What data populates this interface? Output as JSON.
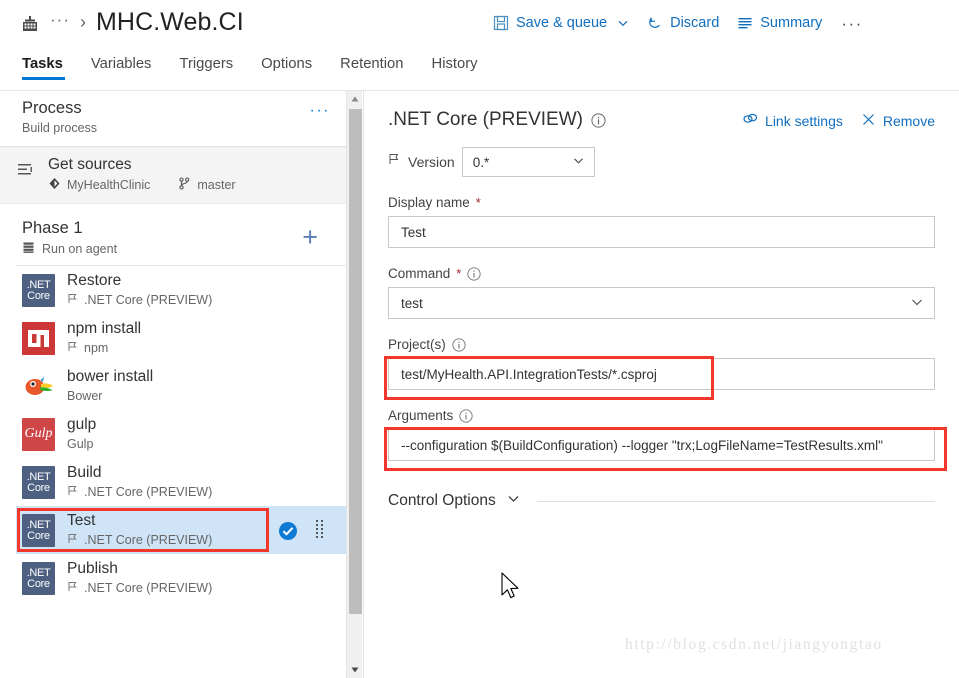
{
  "header": {
    "breadcrumb": {
      "home_icon": "build-definition-icon",
      "overflow": "···",
      "separator": "›",
      "title": "MHC.Web.CI"
    },
    "toolbar": {
      "save_queue_label": "Save & queue",
      "save_icon": "save-icon",
      "caret_icon": "chevron-down-icon",
      "discard_label": "Discard",
      "discard_icon": "undo-icon",
      "summary_label": "Summary",
      "summary_icon": "list-icon",
      "more_label": "···"
    }
  },
  "tabs": [
    {
      "label": "Tasks",
      "active": true
    },
    {
      "label": "Variables",
      "active": false
    },
    {
      "label": "Triggers",
      "active": false
    },
    {
      "label": "Options",
      "active": false
    },
    {
      "label": "Retention",
      "active": false
    },
    {
      "label": "History",
      "active": false
    }
  ],
  "sidebar": {
    "process": {
      "title": "Process",
      "subtitle": "Build process",
      "more_label": "···"
    },
    "get_sources": {
      "icon": "get-sources-icon",
      "title": "Get sources",
      "repo_icon": "repository-icon",
      "repo": "MyHealthClinic",
      "branch_icon": "branch-icon",
      "branch": "master"
    },
    "phase": {
      "title": "Phase 1",
      "agent_icon": "agent-icon",
      "subtitle": "Run on agent",
      "add_label": "+"
    },
    "tasks": [
      {
        "name": "Restore",
        "subtitle": ".NET Core (PREVIEW)",
        "icon": "dotnet-core-icon",
        "icon_type": "netcore",
        "has_flag": true,
        "selected": false
      },
      {
        "name": "npm install",
        "subtitle": "npm",
        "icon": "npm-icon",
        "icon_type": "npm",
        "has_flag": true,
        "selected": false
      },
      {
        "name": "bower install",
        "subtitle": "Bower",
        "icon": "bower-icon",
        "icon_type": "bower",
        "has_flag": false,
        "selected": false
      },
      {
        "name": "gulp",
        "subtitle": "Gulp",
        "icon": "gulp-icon",
        "icon_type": "gulp",
        "has_flag": false,
        "selected": false
      },
      {
        "name": "Build",
        "subtitle": ".NET Core (PREVIEW)",
        "icon": "dotnet-core-icon",
        "icon_type": "netcore",
        "has_flag": true,
        "selected": false
      },
      {
        "name": "Test",
        "subtitle": ".NET Core (PREVIEW)",
        "icon": "dotnet-core-icon",
        "icon_type": "netcore",
        "has_flag": true,
        "selected": true
      },
      {
        "name": "Publish",
        "subtitle": ".NET Core (PREVIEW)",
        "icon": "dotnet-core-icon",
        "icon_type": "netcore",
        "has_flag": true,
        "selected": false
      }
    ],
    "netcore_icon_text": {
      "line1": ".NET",
      "line2": "Core"
    },
    "gulp_icon_text": "Gulp"
  },
  "main": {
    "title": ".NET Core (PREVIEW)",
    "info_icon": "info-icon",
    "link_settings_label": "Link settings",
    "link_settings_icon": "link-icon",
    "remove_label": "Remove",
    "remove_icon": "close-icon",
    "version": {
      "flag_icon": "version-flag-icon",
      "label": "Version",
      "value": "0.*",
      "caret_icon": "chevron-down-icon"
    },
    "fields": [
      {
        "label": "Display name",
        "required": "*",
        "has_info": false,
        "value": "Test",
        "type": "text",
        "highlight": false
      },
      {
        "label": "Command",
        "required": "*",
        "has_info": true,
        "value": "test",
        "type": "select",
        "highlight": false
      },
      {
        "label": "Project(s)",
        "required": "",
        "has_info": true,
        "value": "test/MyHealth.API.IntegrationTests/*.csproj",
        "type": "text",
        "highlight": "project"
      },
      {
        "label": "Arguments",
        "required": "",
        "has_info": true,
        "value": "--configuration $(BuildConfiguration) --logger \"trx;LogFileName=TestResults.xml\"",
        "type": "text",
        "highlight": "args"
      }
    ],
    "control_options": {
      "label": "Control Options",
      "caret_icon": "chevron-down-icon"
    }
  },
  "scrollbar": {
    "up_arrow": "scroll-up-arrow",
    "down_arrow": "scroll-down-arrow"
  },
  "watermark": "http://blog.csdn.net/jiangyongtao",
  "colors": {
    "accent": "#0078d4",
    "link": "#106ebe",
    "highlight_red": "#f4372b",
    "selected_row": "#cfe4f7",
    "netcore_icon": "#4d6082",
    "npm_icon": "#cb3837",
    "gulp_icon": "#cf4647",
    "required_asterisk": "#a4262c"
  }
}
